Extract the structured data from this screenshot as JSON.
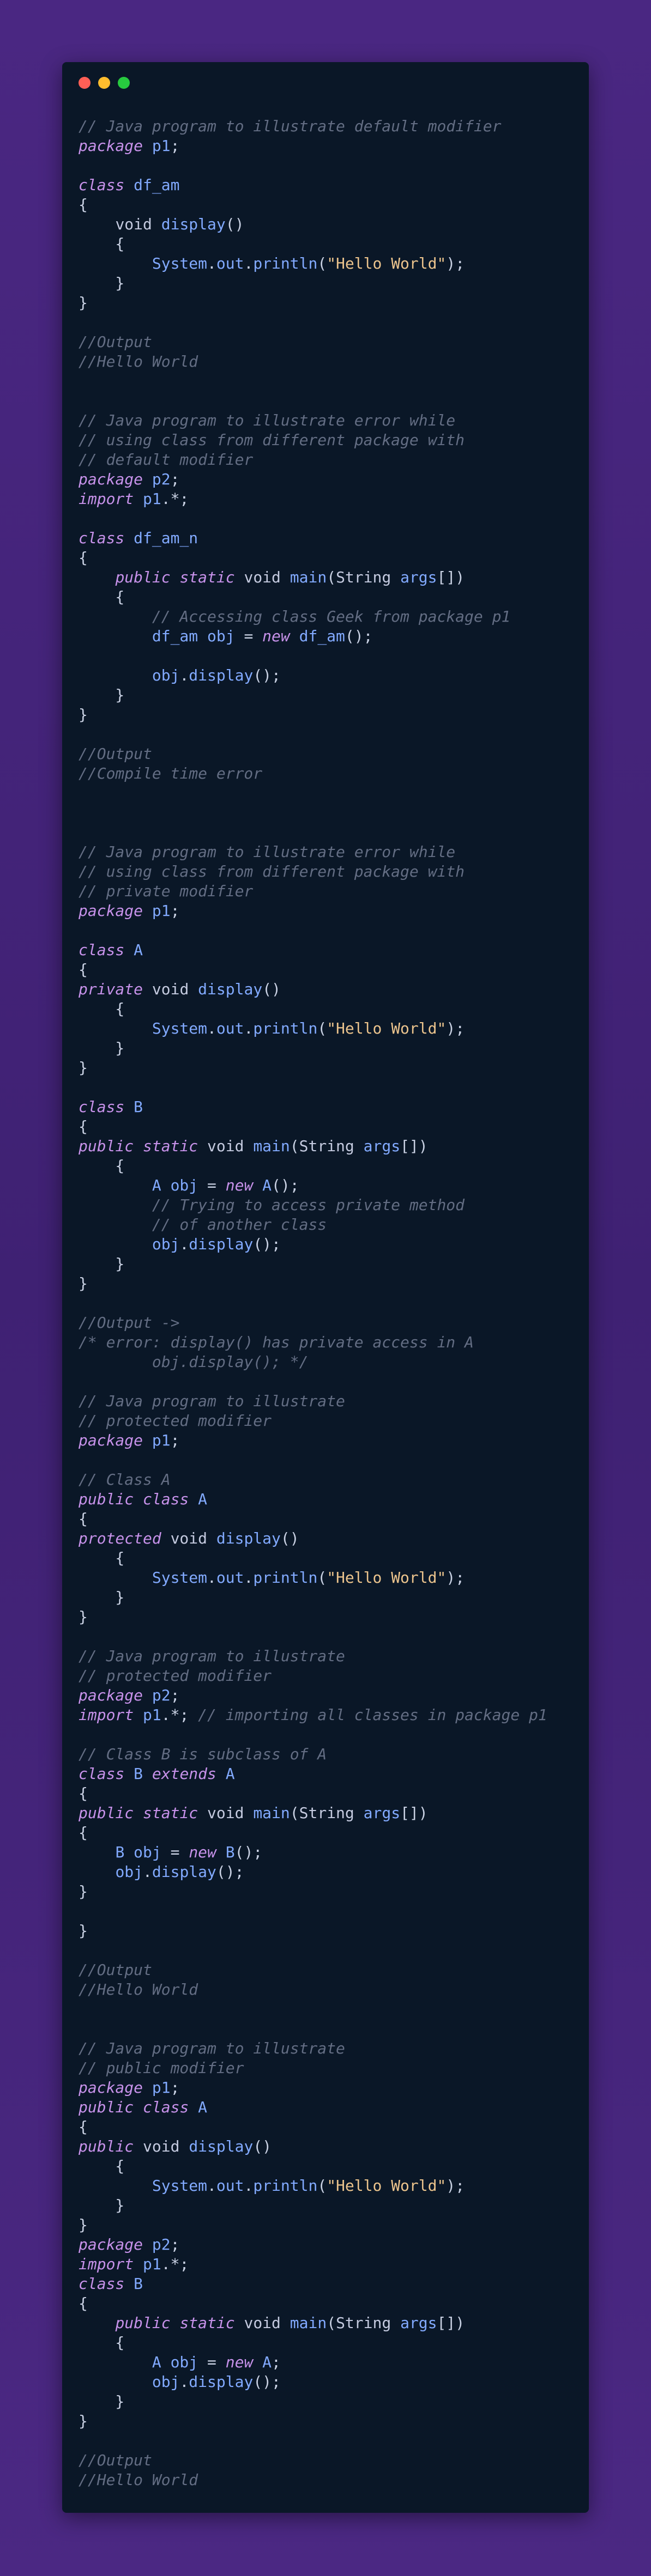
{
  "window": {
    "buttons": [
      "close",
      "minimize",
      "maximize"
    ]
  },
  "colors": {
    "background": "#45257c",
    "editor": "#0a1727",
    "comment": "#636d83",
    "keyword": "#c792ea",
    "function": "#82aaff",
    "string": "#ecc48d",
    "plain": "#c9d1e3"
  },
  "code": {
    "lines": [
      [
        [
          "comment",
          "// Java program to illustrate default modifier"
        ]
      ],
      [
        [
          "keyword",
          "package"
        ],
        [
          "plain",
          " "
        ],
        [
          "ident",
          "p1"
        ],
        [
          "plain",
          ";"
        ]
      ],
      [],
      [
        [
          "keyword",
          "class"
        ],
        [
          "plain",
          " "
        ],
        [
          "ident",
          "df_am"
        ]
      ],
      [
        [
          "plain",
          "{"
        ]
      ],
      [
        [
          "plain",
          "    "
        ],
        [
          "type",
          "void"
        ],
        [
          "plain",
          " "
        ],
        [
          "func",
          "display"
        ],
        [
          "plain",
          "()"
        ]
      ],
      [
        [
          "plain",
          "    {"
        ]
      ],
      [
        [
          "plain",
          "        "
        ],
        [
          "ident",
          "System"
        ],
        [
          "plain",
          "."
        ],
        [
          "ident",
          "out"
        ],
        [
          "plain",
          "."
        ],
        [
          "func",
          "println"
        ],
        [
          "plain",
          "("
        ],
        [
          "string",
          "\"Hello World\""
        ],
        [
          "plain",
          ");"
        ]
      ],
      [
        [
          "plain",
          "    }"
        ]
      ],
      [
        [
          "plain",
          "}"
        ]
      ],
      [],
      [
        [
          "comment",
          "//Output"
        ]
      ],
      [
        [
          "comment",
          "//Hello World"
        ]
      ],
      [],
      [],
      [
        [
          "comment",
          "// Java program to illustrate error while"
        ]
      ],
      [
        [
          "comment",
          "// using class from different package with"
        ]
      ],
      [
        [
          "comment",
          "// default modifier"
        ]
      ],
      [
        [
          "keyword",
          "package"
        ],
        [
          "plain",
          " "
        ],
        [
          "ident",
          "p2"
        ],
        [
          "plain",
          ";"
        ]
      ],
      [
        [
          "keyword",
          "import"
        ],
        [
          "plain",
          " "
        ],
        [
          "ident",
          "p1"
        ],
        [
          "plain",
          ".*;"
        ]
      ],
      [],
      [
        [
          "keyword",
          "class"
        ],
        [
          "plain",
          " "
        ],
        [
          "ident",
          "df_am_n"
        ]
      ],
      [
        [
          "plain",
          "{"
        ]
      ],
      [
        [
          "plain",
          "    "
        ],
        [
          "keyword",
          "public"
        ],
        [
          "plain",
          " "
        ],
        [
          "keyword",
          "static"
        ],
        [
          "plain",
          " "
        ],
        [
          "type",
          "void"
        ],
        [
          "plain",
          " "
        ],
        [
          "func",
          "main"
        ],
        [
          "plain",
          "("
        ],
        [
          "type",
          "String"
        ],
        [
          "plain",
          " "
        ],
        [
          "ident",
          "args"
        ],
        [
          "plain",
          "[])"
        ]
      ],
      [
        [
          "plain",
          "    {"
        ]
      ],
      [
        [
          "plain",
          "        "
        ],
        [
          "comment",
          "// Accessing class Geek from package p1"
        ]
      ],
      [
        [
          "plain",
          "        "
        ],
        [
          "ident",
          "df_am"
        ],
        [
          "plain",
          " "
        ],
        [
          "ident",
          "obj"
        ],
        [
          "plain",
          " = "
        ],
        [
          "keyword",
          "new"
        ],
        [
          "plain",
          " "
        ],
        [
          "func",
          "df_am"
        ],
        [
          "plain",
          "();"
        ]
      ],
      [],
      [
        [
          "plain",
          "        "
        ],
        [
          "ident",
          "obj"
        ],
        [
          "plain",
          "."
        ],
        [
          "func",
          "display"
        ],
        [
          "plain",
          "();"
        ]
      ],
      [
        [
          "plain",
          "    }"
        ]
      ],
      [
        [
          "plain",
          "}"
        ]
      ],
      [],
      [
        [
          "comment",
          "//Output"
        ]
      ],
      [
        [
          "comment",
          "//Compile time error"
        ]
      ],
      [],
      [],
      [],
      [
        [
          "comment",
          "// Java program to illustrate error while"
        ]
      ],
      [
        [
          "comment",
          "// using class from different package with"
        ]
      ],
      [
        [
          "comment",
          "// private modifier"
        ]
      ],
      [
        [
          "keyword",
          "package"
        ],
        [
          "plain",
          " "
        ],
        [
          "ident",
          "p1"
        ],
        [
          "plain",
          ";"
        ]
      ],
      [],
      [
        [
          "keyword",
          "class"
        ],
        [
          "plain",
          " "
        ],
        [
          "ident",
          "A"
        ]
      ],
      [
        [
          "plain",
          "{"
        ]
      ],
      [
        [
          "keyword",
          "private"
        ],
        [
          "plain",
          " "
        ],
        [
          "type",
          "void"
        ],
        [
          "plain",
          " "
        ],
        [
          "func",
          "display"
        ],
        [
          "plain",
          "()"
        ]
      ],
      [
        [
          "plain",
          "    {"
        ]
      ],
      [
        [
          "plain",
          "        "
        ],
        [
          "ident",
          "System"
        ],
        [
          "plain",
          "."
        ],
        [
          "ident",
          "out"
        ],
        [
          "plain",
          "."
        ],
        [
          "func",
          "println"
        ],
        [
          "plain",
          "("
        ],
        [
          "string",
          "\"Hello World\""
        ],
        [
          "plain",
          ");"
        ]
      ],
      [
        [
          "plain",
          "    }"
        ]
      ],
      [
        [
          "plain",
          "}"
        ]
      ],
      [],
      [
        [
          "keyword",
          "class"
        ],
        [
          "plain",
          " "
        ],
        [
          "ident",
          "B"
        ]
      ],
      [
        [
          "plain",
          "{"
        ]
      ],
      [
        [
          "keyword",
          "public"
        ],
        [
          "plain",
          " "
        ],
        [
          "keyword",
          "static"
        ],
        [
          "plain",
          " "
        ],
        [
          "type",
          "void"
        ],
        [
          "plain",
          " "
        ],
        [
          "func",
          "main"
        ],
        [
          "plain",
          "("
        ],
        [
          "type",
          "String"
        ],
        [
          "plain",
          " "
        ],
        [
          "ident",
          "args"
        ],
        [
          "plain",
          "[])"
        ]
      ],
      [
        [
          "plain",
          "    {"
        ]
      ],
      [
        [
          "plain",
          "        "
        ],
        [
          "ident",
          "A"
        ],
        [
          "plain",
          " "
        ],
        [
          "ident",
          "obj"
        ],
        [
          "plain",
          " = "
        ],
        [
          "keyword",
          "new"
        ],
        [
          "plain",
          " "
        ],
        [
          "func",
          "A"
        ],
        [
          "plain",
          "();"
        ]
      ],
      [
        [
          "plain",
          "        "
        ],
        [
          "comment",
          "// Trying to access private method"
        ]
      ],
      [
        [
          "plain",
          "        "
        ],
        [
          "comment",
          "// of another class"
        ]
      ],
      [
        [
          "plain",
          "        "
        ],
        [
          "ident",
          "obj"
        ],
        [
          "plain",
          "."
        ],
        [
          "func",
          "display"
        ],
        [
          "plain",
          "();"
        ]
      ],
      [
        [
          "plain",
          "    }"
        ]
      ],
      [
        [
          "plain",
          "}"
        ]
      ],
      [],
      [
        [
          "comment",
          "//Output ->"
        ]
      ],
      [
        [
          "comment",
          "/* error: display() has private access in A"
        ]
      ],
      [
        [
          "comment",
          "        obj.display(); */"
        ]
      ],
      [],
      [
        [
          "comment",
          "// Java program to illustrate"
        ]
      ],
      [
        [
          "comment",
          "// protected modifier"
        ]
      ],
      [
        [
          "keyword",
          "package"
        ],
        [
          "plain",
          " "
        ],
        [
          "ident",
          "p1"
        ],
        [
          "plain",
          ";"
        ]
      ],
      [],
      [
        [
          "comment",
          "// Class A"
        ]
      ],
      [
        [
          "keyword",
          "public"
        ],
        [
          "plain",
          " "
        ],
        [
          "keyword",
          "class"
        ],
        [
          "plain",
          " "
        ],
        [
          "ident",
          "A"
        ]
      ],
      [
        [
          "plain",
          "{"
        ]
      ],
      [
        [
          "keyword",
          "protected"
        ],
        [
          "plain",
          " "
        ],
        [
          "type",
          "void"
        ],
        [
          "plain",
          " "
        ],
        [
          "func",
          "display"
        ],
        [
          "plain",
          "()"
        ]
      ],
      [
        [
          "plain",
          "    {"
        ]
      ],
      [
        [
          "plain",
          "        "
        ],
        [
          "ident",
          "System"
        ],
        [
          "plain",
          "."
        ],
        [
          "ident",
          "out"
        ],
        [
          "plain",
          "."
        ],
        [
          "func",
          "println"
        ],
        [
          "plain",
          "("
        ],
        [
          "string",
          "\"Hello World\""
        ],
        [
          "plain",
          ");"
        ]
      ],
      [
        [
          "plain",
          "    }"
        ]
      ],
      [
        [
          "plain",
          "}"
        ]
      ],
      [],
      [
        [
          "comment",
          "// Java program to illustrate"
        ]
      ],
      [
        [
          "comment",
          "// protected modifier"
        ]
      ],
      [
        [
          "keyword",
          "package"
        ],
        [
          "plain",
          " "
        ],
        [
          "ident",
          "p2"
        ],
        [
          "plain",
          ";"
        ]
      ],
      [
        [
          "keyword",
          "import"
        ],
        [
          "plain",
          " "
        ],
        [
          "ident",
          "p1"
        ],
        [
          "plain",
          ".*; "
        ],
        [
          "comment",
          "// importing all classes in package p1"
        ]
      ],
      [],
      [
        [
          "comment",
          "// Class B is subclass of A"
        ]
      ],
      [
        [
          "keyword",
          "class"
        ],
        [
          "plain",
          " "
        ],
        [
          "ident",
          "B"
        ],
        [
          "plain",
          " "
        ],
        [
          "keyword",
          "extends"
        ],
        [
          "plain",
          " "
        ],
        [
          "ident",
          "A"
        ]
      ],
      [
        [
          "plain",
          "{"
        ]
      ],
      [
        [
          "keyword",
          "public"
        ],
        [
          "plain",
          " "
        ],
        [
          "keyword",
          "static"
        ],
        [
          "plain",
          " "
        ],
        [
          "type",
          "void"
        ],
        [
          "plain",
          " "
        ],
        [
          "func",
          "main"
        ],
        [
          "plain",
          "("
        ],
        [
          "type",
          "String"
        ],
        [
          "plain",
          " "
        ],
        [
          "ident",
          "args"
        ],
        [
          "plain",
          "[])"
        ]
      ],
      [
        [
          "plain",
          "{"
        ]
      ],
      [
        [
          "plain",
          "    "
        ],
        [
          "ident",
          "B"
        ],
        [
          "plain",
          " "
        ],
        [
          "ident",
          "obj"
        ],
        [
          "plain",
          " = "
        ],
        [
          "keyword",
          "new"
        ],
        [
          "plain",
          " "
        ],
        [
          "func",
          "B"
        ],
        [
          "plain",
          "();"
        ]
      ],
      [
        [
          "plain",
          "    "
        ],
        [
          "ident",
          "obj"
        ],
        [
          "plain",
          "."
        ],
        [
          "func",
          "display"
        ],
        [
          "plain",
          "();"
        ]
      ],
      [
        [
          "plain",
          "}"
        ]
      ],
      [],
      [
        [
          "plain",
          "}"
        ]
      ],
      [],
      [
        [
          "comment",
          "//Output"
        ]
      ],
      [
        [
          "comment",
          "//Hello World"
        ]
      ],
      [],
      [],
      [
        [
          "comment",
          "// Java program to illustrate"
        ]
      ],
      [
        [
          "comment",
          "// public modifier"
        ]
      ],
      [
        [
          "keyword",
          "package"
        ],
        [
          "plain",
          " "
        ],
        [
          "ident",
          "p1"
        ],
        [
          "plain",
          ";"
        ]
      ],
      [
        [
          "keyword",
          "public"
        ],
        [
          "plain",
          " "
        ],
        [
          "keyword",
          "class"
        ],
        [
          "plain",
          " "
        ],
        [
          "ident",
          "A"
        ]
      ],
      [
        [
          "plain",
          "{"
        ]
      ],
      [
        [
          "keyword",
          "public"
        ],
        [
          "plain",
          " "
        ],
        [
          "type",
          "void"
        ],
        [
          "plain",
          " "
        ],
        [
          "func",
          "display"
        ],
        [
          "plain",
          "()"
        ]
      ],
      [
        [
          "plain",
          "    {"
        ]
      ],
      [
        [
          "plain",
          "        "
        ],
        [
          "ident",
          "System"
        ],
        [
          "plain",
          "."
        ],
        [
          "ident",
          "out"
        ],
        [
          "plain",
          "."
        ],
        [
          "func",
          "println"
        ],
        [
          "plain",
          "("
        ],
        [
          "string",
          "\"Hello World\""
        ],
        [
          "plain",
          ");"
        ]
      ],
      [
        [
          "plain",
          "    }"
        ]
      ],
      [
        [
          "plain",
          "}"
        ]
      ],
      [
        [
          "keyword",
          "package"
        ],
        [
          "plain",
          " "
        ],
        [
          "ident",
          "p2"
        ],
        [
          "plain",
          ";"
        ]
      ],
      [
        [
          "keyword",
          "import"
        ],
        [
          "plain",
          " "
        ],
        [
          "ident",
          "p1"
        ],
        [
          "plain",
          ".*;"
        ]
      ],
      [
        [
          "keyword",
          "class"
        ],
        [
          "plain",
          " "
        ],
        [
          "ident",
          "B"
        ]
      ],
      [
        [
          "plain",
          "{"
        ]
      ],
      [
        [
          "plain",
          "    "
        ],
        [
          "keyword",
          "public"
        ],
        [
          "plain",
          " "
        ],
        [
          "keyword",
          "static"
        ],
        [
          "plain",
          " "
        ],
        [
          "type",
          "void"
        ],
        [
          "plain",
          " "
        ],
        [
          "func",
          "main"
        ],
        [
          "plain",
          "("
        ],
        [
          "type",
          "String"
        ],
        [
          "plain",
          " "
        ],
        [
          "ident",
          "args"
        ],
        [
          "plain",
          "[])"
        ]
      ],
      [
        [
          "plain",
          "    {"
        ]
      ],
      [
        [
          "plain",
          "        "
        ],
        [
          "ident",
          "A"
        ],
        [
          "plain",
          " "
        ],
        [
          "ident",
          "obj"
        ],
        [
          "plain",
          " = "
        ],
        [
          "keyword",
          "new"
        ],
        [
          "plain",
          " "
        ],
        [
          "ident",
          "A"
        ],
        [
          "plain",
          ";"
        ]
      ],
      [
        [
          "plain",
          "        "
        ],
        [
          "ident",
          "obj"
        ],
        [
          "plain",
          "."
        ],
        [
          "func",
          "display"
        ],
        [
          "plain",
          "();"
        ]
      ],
      [
        [
          "plain",
          "    }"
        ]
      ],
      [
        [
          "plain",
          "}"
        ]
      ],
      [],
      [
        [
          "comment",
          "//Output"
        ]
      ],
      [
        [
          "comment",
          "//Hello World"
        ]
      ]
    ]
  }
}
